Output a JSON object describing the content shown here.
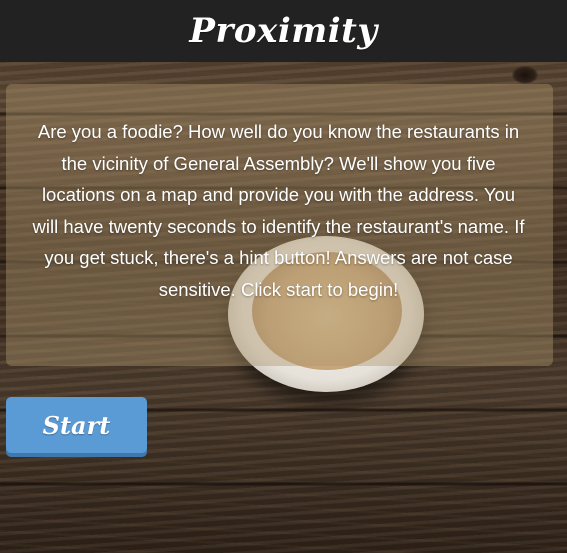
{
  "header": {
    "title": "Proximity"
  },
  "intro": {
    "text": "Are you a foodie? How well do you know the restaurants in the vicinity of General Assembly? We'll show you five locations on a map and provide you with the address. You will have twenty seconds to identify the restaurant's name. If you get stuck, there's a hint button! Answers are not case sensitive. Click start to begin!"
  },
  "actions": {
    "start_label": "Start"
  },
  "colors": {
    "header_bg": "#222222",
    "button_bg": "#5b9bd5",
    "text": "#ffffff"
  }
}
